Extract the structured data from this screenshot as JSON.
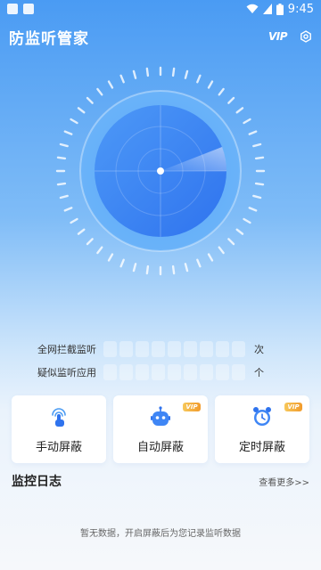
{
  "status_bar": {
    "time": "9:45"
  },
  "app_bar": {
    "title": "防监听管家",
    "vip_label": "VIP"
  },
  "stats": [
    {
      "label": "全网拦截监听",
      "unit": "次"
    },
    {
      "label": "疑似监听应用",
      "unit": "个"
    }
  ],
  "cards": [
    {
      "label": "手动屏蔽",
      "vip": ""
    },
    {
      "label": "自动屏蔽",
      "vip": "VIP"
    },
    {
      "label": "定时屏蔽",
      "vip": "VIP"
    }
  ],
  "log": {
    "title": "监控日志",
    "more": "查看更多>>",
    "empty": "暂无数据，开启屏蔽后为您记录监听数据"
  },
  "colors": {
    "primary": "#4a9bf3",
    "radar_inner": "#3f86f5",
    "vip_gold": "#f19a2b"
  }
}
